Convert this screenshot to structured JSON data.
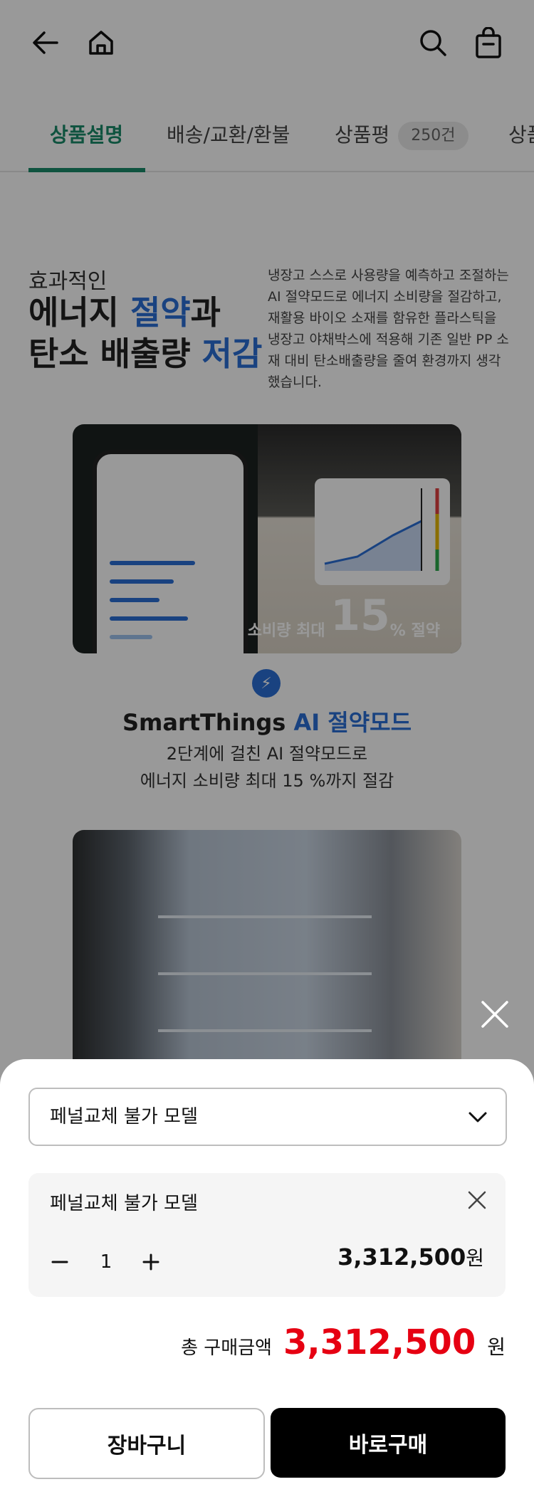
{
  "header": {
    "back_icon": "arrow-left-icon",
    "home_icon": "home-icon",
    "search_icon": "search-icon",
    "cart_icon": "shopping-bag-icon"
  },
  "tabs": [
    {
      "label": "상품설명",
      "active": true
    },
    {
      "label": "배송/교환/환불",
      "active": false
    },
    {
      "label": "상품평",
      "badge": "250건",
      "active": false
    },
    {
      "label": "상품",
      "active": false
    }
  ],
  "intro": {
    "small": "효과적인",
    "title_line1_a": "에너지 ",
    "title_line1_accent": "절약",
    "title_line1_b": "과",
    "title_line2_a": "탄소 배출량 ",
    "title_line2_accent": "저감",
    "description": "냉장고 스스로 사용량을 예측하고 조절하는 AI 절약모드로 에너지 소비량을 절감하고, 재활용 바이오 소재를 함유한 플라스틱을 냉장고 야채박스에 적용해 기존 일반 PP 소재 대비 탄소배출량을 줄여 환경까지 생각했습니다."
  },
  "image1": {
    "caption_prefix": "에너지 소비량 최대",
    "caption_value": "15",
    "caption_unit": "%",
    "caption_suffix": "절약"
  },
  "smartthings": {
    "title_a": "SmartThings ",
    "title_accent": "AI 절약모드",
    "desc_line1": "2단계에 걸친 AI 절약모드로",
    "desc_line2": "에너지 소비량 최대 15 %까지 절감"
  },
  "sheet": {
    "select_value": "페널교체 불가 모델",
    "option": {
      "name": "페널교체 불가 모델",
      "quantity": "1",
      "price": "3,312,500",
      "currency": "원"
    },
    "total_label": "총 구매금액",
    "total_amount": "3,312,500",
    "total_currency": "원",
    "cart_label": "장바구니",
    "buy_label": "바로구매"
  },
  "colors": {
    "accent_green": "#1a8a6a",
    "accent_blue": "#2a6fd6",
    "price_red": "#e60012"
  }
}
